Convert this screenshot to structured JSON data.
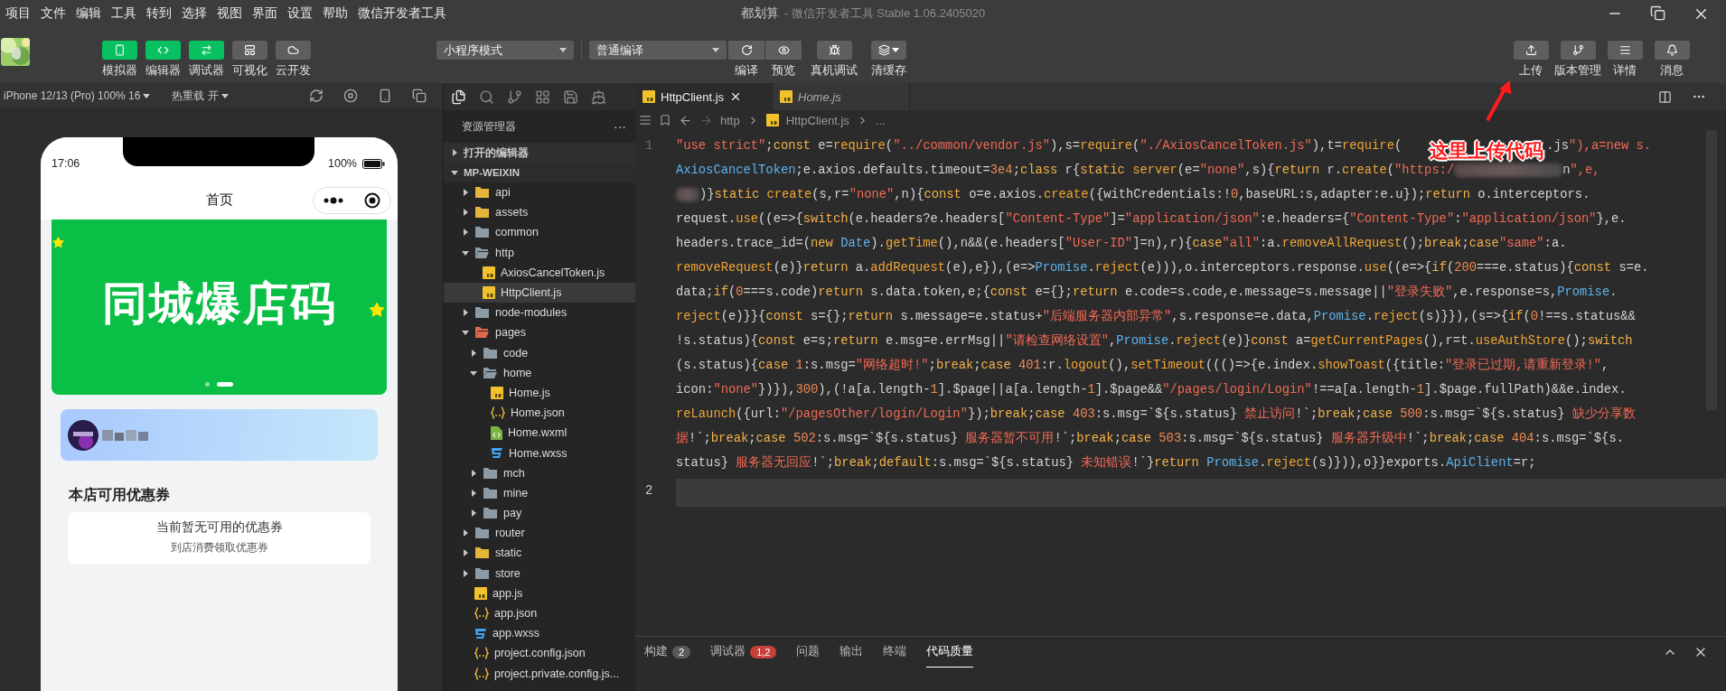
{
  "window": {
    "title": "都划算",
    "subtitle": "- 微信开发者工具 Stable 1.06.2405020"
  },
  "menu": [
    "项目",
    "文件",
    "编辑",
    "工具",
    "转到",
    "选择",
    "视图",
    "界面",
    "设置",
    "帮助",
    "微信开发者工具"
  ],
  "toolbar": {
    "modes": [
      {
        "label": "模拟器",
        "selected": true
      },
      {
        "label": "编辑器",
        "selected": true
      },
      {
        "label": "调试器",
        "selected": true
      },
      {
        "label": "可视化",
        "selected": false
      },
      {
        "label": "云开发",
        "selected": false
      }
    ],
    "mode_select": "小程序模式",
    "compile_select": "普通编译",
    "actions": [
      "编译",
      "预览",
      "真机调试",
      "清缓存"
    ],
    "right_actions": [
      "上传",
      "版本管理",
      "详情",
      "消息"
    ]
  },
  "simulator": {
    "device": "iPhone 12/13 (Pro) 100% 16",
    "hot_reload": "热重载 开",
    "phone": {
      "time": "17:06",
      "battery": "100%",
      "nav_title": "首页",
      "banner": {
        "title": "同城爆店码",
        "dots": [
          {
            "selected": false
          },
          {
            "selected": true
          }
        ]
      },
      "section_title": "本店可用优惠券",
      "empty": {
        "title": "当前暂无可用的优惠券",
        "hint": "到店消费领取优惠券"
      }
    }
  },
  "explorer": {
    "title": "资源管理器",
    "more": "···",
    "sections": [
      {
        "label": "打开的编辑器",
        "expanded": false
      },
      {
        "label": "MP-WEIXIN",
        "expanded": true
      }
    ],
    "tree": [
      {
        "label": "api",
        "kind": "folder",
        "color": "#e5b43b",
        "expanded": false,
        "selected": false
      },
      {
        "label": "assets",
        "kind": "folder",
        "color": "#e5b43b",
        "expanded": false,
        "selected": false
      },
      {
        "label": "common",
        "kind": "folder",
        "color": "#8c9ba5",
        "expanded": false,
        "selected": false
      },
      {
        "label": "http",
        "kind": "folder",
        "color": "#8c9ba5",
        "expanded": true,
        "selected": false,
        "children": [
          {
            "label": "AxiosCancelToken.js",
            "kind": "js",
            "selected": false
          },
          {
            "label": "HttpClient.js",
            "kind": "js",
            "selected": true
          }
        ]
      },
      {
        "label": "node-modules",
        "kind": "folder",
        "color": "#8c9ba5",
        "expanded": false,
        "selected": false
      },
      {
        "label": "pages",
        "kind": "folder",
        "color": "#e2674f",
        "expanded": true,
        "selected": false,
        "children": [
          {
            "label": "code",
            "kind": "folder",
            "color": "#8c9ba5",
            "expanded": false,
            "selected": false
          },
          {
            "label": "home",
            "kind": "folder",
            "color": "#8c9ba5",
            "expanded": true,
            "selected": false,
            "children": [
              {
                "label": "Home.js",
                "kind": "js",
                "selected": false
              },
              {
                "label": "Home.json",
                "kind": "json",
                "selected": false
              },
              {
                "label": "Home.wxml",
                "kind": "wxml",
                "selected": false
              },
              {
                "label": "Home.wxss",
                "kind": "wxss",
                "selected": false
              }
            ]
          },
          {
            "label": "mch",
            "kind": "folder",
            "color": "#8c9ba5",
            "expanded": false,
            "selected": false
          },
          {
            "label": "mine",
            "kind": "folder",
            "color": "#8c9ba5",
            "expanded": false,
            "selected": false
          },
          {
            "label": "pay",
            "kind": "folder",
            "color": "#8c9ba5",
            "expanded": false,
            "selected": false
          }
        ]
      },
      {
        "label": "router",
        "kind": "folder",
        "color": "#8c9ba5",
        "expanded": false,
        "selected": false
      },
      {
        "label": "static",
        "kind": "folder",
        "color": "#e5b43b",
        "expanded": false,
        "selected": false
      },
      {
        "label": "store",
        "kind": "folder",
        "color": "#8c9ba5",
        "expanded": false,
        "selected": false
      },
      {
        "label": "app.js",
        "kind": "js",
        "selected": false
      },
      {
        "label": "app.json",
        "kind": "json",
        "selected": false
      },
      {
        "label": "app.wxss",
        "kind": "wxss",
        "selected": false
      },
      {
        "label": "project.config.json",
        "kind": "json",
        "selected": false
      },
      {
        "label": "project.private.config.js...",
        "kind": "json",
        "selected": false
      }
    ]
  },
  "editor": {
    "tabs": [
      {
        "label": "HttpClient.js",
        "kind": "js",
        "selected": true,
        "preview": false
      },
      {
        "label": "Home.js",
        "kind": "js",
        "selected": false,
        "preview": true
      }
    ],
    "breadcrumb": [
      {
        "label": "http",
        "kind": "folder"
      },
      {
        "label": "HttpClient.js",
        "kind": "js"
      },
      {
        "label": "...",
        "kind": "more"
      }
    ],
    "lines": [
      {
        "number": "1",
        "current": false,
        "rows": [
          [
            {
              "kind": "code",
              "text": "\"use strict\";const e=require(\"../common/vendor.js\"),s=require(\"./AxiosCancelToken.js\"),t=require("
            },
            {
              "kind": "covered"
            },
            {
              "kind": "code",
              "text": ".js\"),a=new s."
            }
          ],
          [
            {
              "kind": "code",
              "text": "AxiosCancelToken;e.axios.defaults.timeout=3e4;class r{static server(e=\"none\",s){return r.create(\"https:/"
            },
            {
              "kind": "blur"
            },
            {
              "kind": "code",
              "text": "n\",e,"
            }
          ],
          [
            {
              "kind": "blur"
            },
            {
              "kind": "code",
              "text": ")}static create(s,r=\"none\",n){const o=e.axios.create({withCredentials:!0,baseURL:s,adapter:e.u});return o.interceptors."
            }
          ],
          [
            {
              "kind": "code",
              "text": "request.use((e=>{switch(e.headers?e.headers[\"Content-Type\"]=\"application/json\":e.headers={\"Content-Type\":\"application/json\"},e."
            }
          ],
          [
            {
              "kind": "code",
              "text": "headers.trace_id=(new Date).getTime(),n&&(e.headers[\"User-ID\"]=n),r){case\"all\":a.removeAllRequest();break;case\"same\":a."
            }
          ],
          [
            {
              "kind": "code",
              "text": "removeRequest(e)}return a.addRequest(e),e}),(e=>Promise.reject(e))),o.interceptors.response.use((e=>{if(200===e.status){const s=e."
            }
          ],
          [
            {
              "kind": "code",
              "text": "data;if(0===s.code)return s.data.token,e;{const e={};return e.code=s.code,e.message=s.message||\"登录失败\",e.response=s,Promise."
            }
          ],
          [
            {
              "kind": "code",
              "text": "reject(e)}}{const s={};return s.message=e.status+\"后端服务器内部异常\",s.response=e.data,Promise.reject(s)}}),(s=>{if(0!==s.status&&"
            }
          ],
          [
            {
              "kind": "code",
              "text": "!s.status){const e=s;return e.msg=e.errMsg||\"请检查网络设置\",Promise.reject(e)}const a=getCurrentPages(),r=t.useAuthStore();switch"
            }
          ],
          [
            {
              "kind": "code",
              "text": "(s.status){case 1:s.msg=\"网络超时!\";break;case 401:r.logout(),setTimeout((()=>{e.index.showToast({title:\"登录已过期,请重新登录!\","
            }
          ],
          [
            {
              "kind": "code",
              "text": "icon:\"none\"})}),300),(!a[a.length-1].$page||a[a.length-1].$page&&\"/pages/login/Login\"!==a[a.length-1].$page.fullPath)&&e.index."
            }
          ],
          [
            {
              "kind": "code",
              "text": "reLaunch({url:\"/pagesOther/login/Login\"});break;case 403:s.msg=`${s.status} 禁止访问!`;break;case 500:s.msg=`${s.status} 缺少分享数"
            }
          ],
          [
            {
              "kind": "code",
              "text": "据!`;break;case 502:s.msg=`${s.status} 服务器暂不可用!`;break;case 503:s.msg=`${s.status} 服务器升级中!`;break;case 404:s.msg=`${s."
            }
          ],
          [
            {
              "kind": "code",
              "text": "status} 服务器无回应!`;break;default:s.msg=`${s.status} 未知错误!`}return Promise.reject(s)})),o}}exports.ApiClient=r;"
            }
          ]
        ]
      },
      {
        "number": "2",
        "current": true
      }
    ]
  },
  "bottom_panel": {
    "tabs": [
      {
        "label": "构建",
        "badge": "2",
        "color": "#5a5a5a",
        "selected": false
      },
      {
        "label": "调试器",
        "badge": "1,2",
        "color": "#c8403a",
        "selected": false
      },
      {
        "label": "问题",
        "selected": false
      },
      {
        "label": "输出",
        "selected": false
      },
      {
        "label": "终端",
        "selected": false
      },
      {
        "label": "代码质量",
        "selected": true
      }
    ]
  },
  "annotation": {
    "text": "这里上传代码"
  }
}
